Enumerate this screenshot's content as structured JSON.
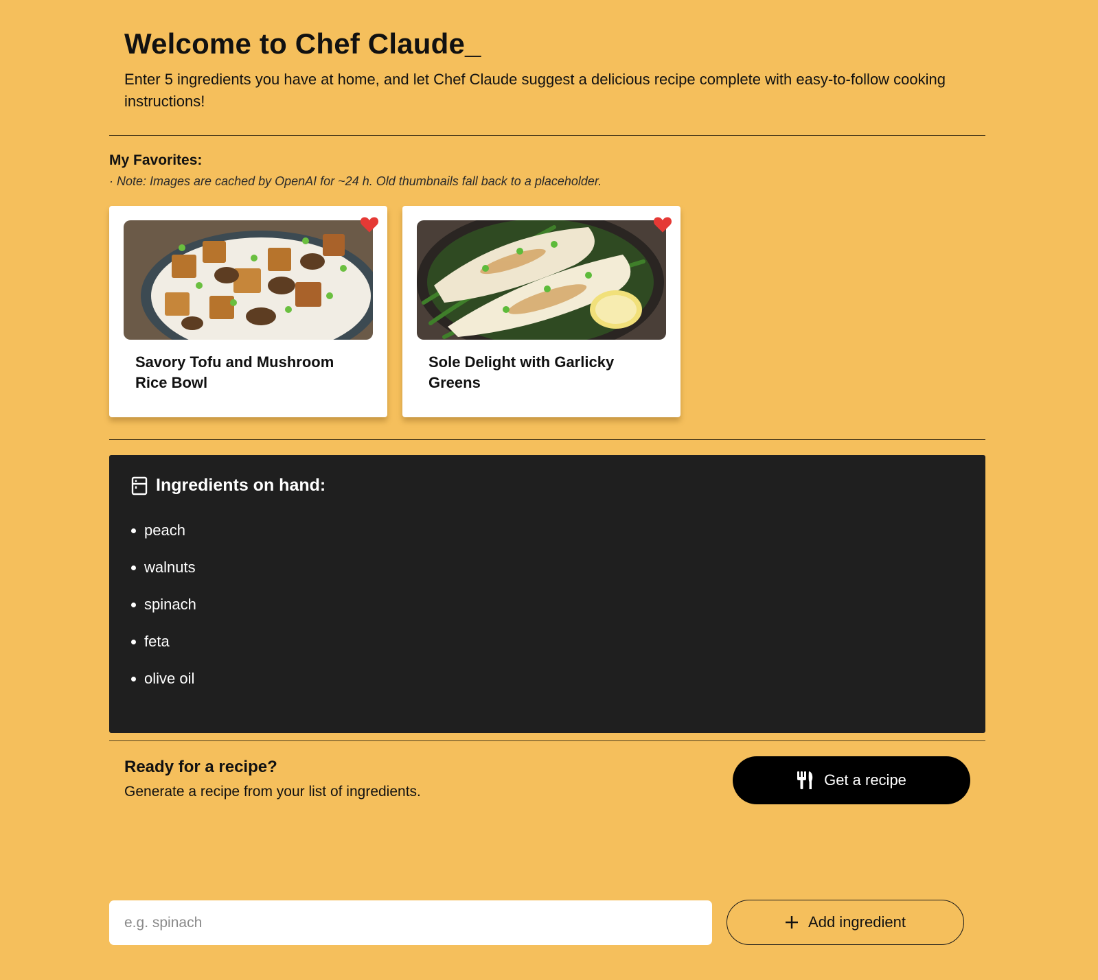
{
  "header": {
    "title": "Welcome to Chef Claude_",
    "subtitle": "Enter 5 ingredients you have at home, and let Chef Claude suggest a delicious recipe complete with easy-to-follow cooking instructions!"
  },
  "favorites": {
    "title": "My Favorites:",
    "note": "· Note: Images are cached by OpenAI for ~24 h. Old thumbnails fall back to a placeholder.",
    "items": [
      {
        "name": "Savory Tofu and Mushroom Rice Bowl",
        "favorited": true
      },
      {
        "name": "Sole Delight with Garlicky Greens",
        "favorited": true
      }
    ]
  },
  "ingredients": {
    "heading": "Ingredients on hand:",
    "items": [
      "peach",
      "walnuts",
      "spinach",
      "feta",
      "olive oil"
    ]
  },
  "ready": {
    "title": "Ready for a recipe?",
    "description": "Generate a recipe from your list of ingredients.",
    "button_label": "Get a recipe"
  },
  "add_form": {
    "placeholder": "e.g. spinach",
    "value": "",
    "button_label": "Add ingredient"
  },
  "colors": {
    "background": "#F5BF5C",
    "panel": "#1F1F1F",
    "heart": "#E53935",
    "button": "#000000"
  },
  "icons": {
    "ingredients": "fridge-icon",
    "get_recipe": "utensils-icon",
    "add": "plus-icon",
    "favorite": "heart-icon"
  }
}
